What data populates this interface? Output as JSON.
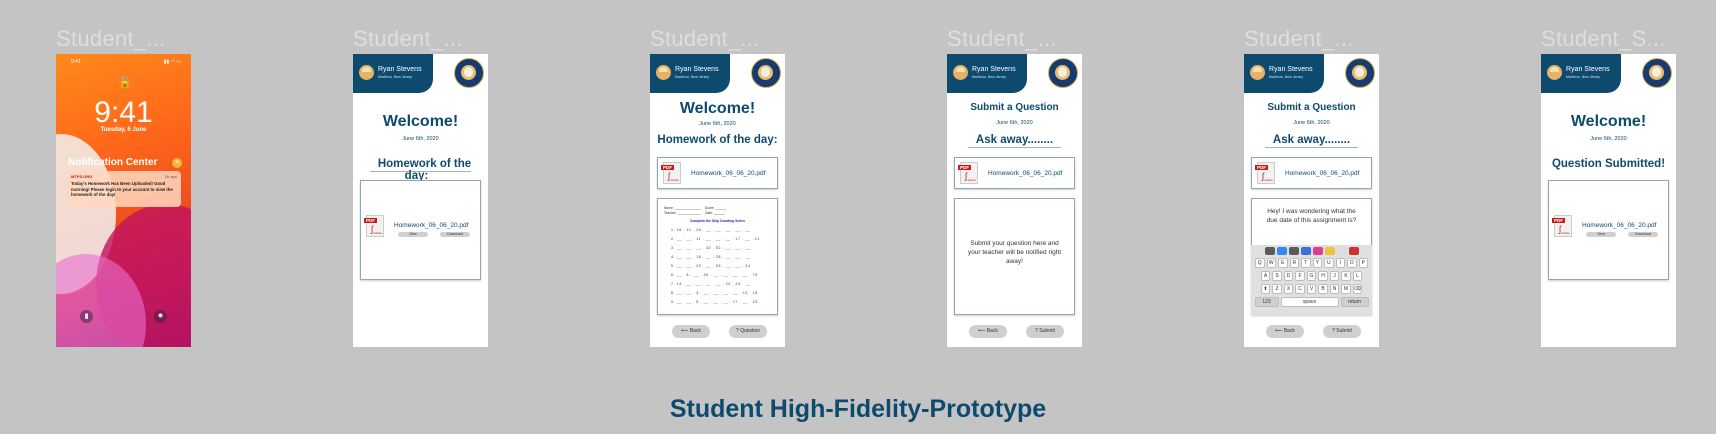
{
  "frame_titles": [
    "Student_...",
    "Student_...",
    "Student_...",
    "Student_...",
    "Student_...",
    "Student_S..."
  ],
  "footer_title": "Student High-Fidelity-Prototype",
  "lock_screen": {
    "status_time": "9:41",
    "clock": "9:41",
    "date": "Tuesday, 6 June",
    "nc_title": "Notification Center",
    "notif_app": "MTPS.ORG",
    "notif_ago": "2h ago",
    "notif_body": "Today's Homework Has Been Uploaded! Good morning! Please login to your account to view the homework of the day!",
    "icons": [
      "lock-icon",
      "flashlight-icon",
      "camera-icon"
    ]
  },
  "header": {
    "name": "Ryan Stevens",
    "location": "Marlboro, New Jersey"
  },
  "welcome": "Welcome!",
  "date": "June 6th, 2020",
  "homework_heading": "Homework of the day:",
  "pdf_icon_tag": "PDF",
  "pdf_icon_label": "Adobe",
  "file_name": "Homework_06_06_20.pdf",
  "view_label": "View",
  "download_label": "Download",
  "worksheet": {
    "name": "Name:",
    "score": "Score:",
    "teacher": "Teacher:",
    "date": "Date:",
    "title": "Complete the Skip Counting Series",
    "rows": [
      "1.   16 .  21 .  26 .  __ .  __ .  __ .  __ .  __",
      "2.   __ .  __ .  11 .  __ .  __ .  __ .  17 .  __ .  21",
      "3.   __ .  __ .  __ .  42 .  52 .  __ .  __ .  __",
      "4.   __ .  __ .  16 .  __ .  28 .  __ .  __ .  __",
      "5.   __ .  __ .  20 .  __ .  26 .  __ .  __ .  24",
      "6.   __ .  8 .  __ .  26 .  __ .  __ .  __ .  __ .  79",
      "7.   14 .  __ .  __ .  __ .  __ .  22 .  24 .  __",
      "8.   __ .  __ .  3 .  __ .  __ .  __ .  __ .  13 .  15",
      "9.   __ .  __ .  5 .  __ .  __ .  __ .  17 .  __ .  23"
    ]
  },
  "back_label": "Back",
  "question_label": "Question",
  "submit_label": "Submit",
  "submit_heading": "Submit a Question",
  "ask_heading": "Ask away........",
  "question_placeholder": "Submit your question here and your teacher will be notified right away!",
  "typed_question": "Hey! I was wondering what the due date of this assignment is?",
  "keyboard": {
    "row1": [
      "Q",
      "W",
      "E",
      "R",
      "T",
      "Y",
      "U",
      "I",
      "O",
      "P"
    ],
    "row2": [
      "A",
      "S",
      "D",
      "F",
      "G",
      "H",
      "J",
      "K",
      "L"
    ],
    "row3": [
      "Z",
      "X",
      "C",
      "V",
      "B",
      "N",
      "M"
    ],
    "shift": "⬆",
    "delete": "⌫",
    "numbers": "123",
    "space": "space",
    "return": "return"
  },
  "question_submitted": "Question Submitted!"
}
